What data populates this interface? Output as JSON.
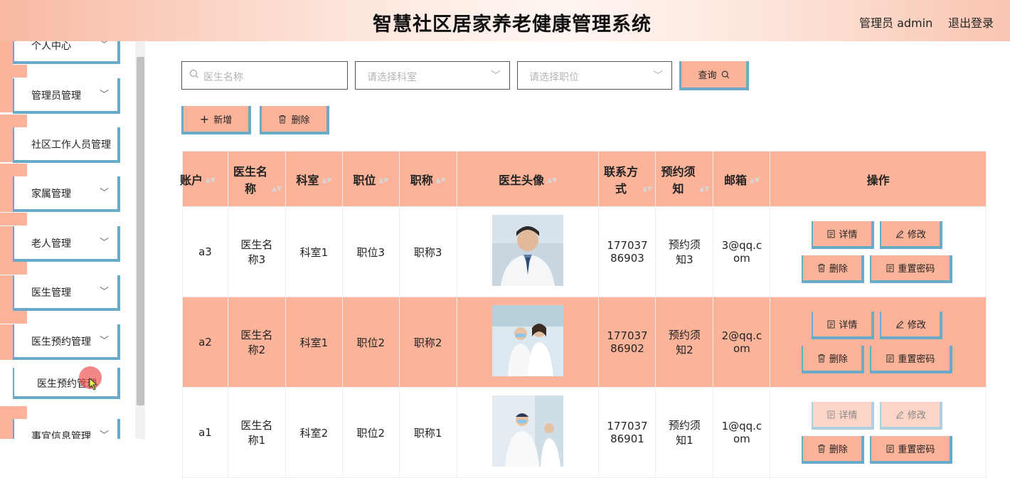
{
  "header": {
    "title": "智慧社区居家养老健康管理系统",
    "user": "管理员 admin",
    "logout": "退出登录"
  },
  "sidebar": {
    "items": [
      {
        "label": "个人中心"
      },
      {
        "label": "管理员管理"
      },
      {
        "label": "社区工作人员管理"
      },
      {
        "label": "家属管理"
      },
      {
        "label": "老人管理"
      },
      {
        "label": "医生管理"
      },
      {
        "label": "医生预约管理"
      },
      {
        "label": "医生预约管理"
      },
      {
        "label": "事宜信息管理"
      }
    ]
  },
  "search": {
    "name_placeholder": "医生名称",
    "dept_placeholder": "请选择科室",
    "position_placeholder": "请选择职位",
    "query_label": "查询"
  },
  "toolbar": {
    "add_label": "新增",
    "delete_label": "删除"
  },
  "table": {
    "headers": [
      "账户",
      "医生名称",
      "科室",
      "职位",
      "职称",
      "医生头像",
      "联系方式",
      "预约须知",
      "邮箱",
      "操作"
    ],
    "rows": [
      {
        "account": "a3",
        "name": "医生名称3",
        "dept": "科室1",
        "position": "职位3",
        "title": "职称3",
        "phone": "17703786903",
        "notice": "预约须知3",
        "email": "3@qq.com"
      },
      {
        "account": "a2",
        "name": "医生名称2",
        "dept": "科室1",
        "position": "职位2",
        "title": "职称2",
        "phone": "17703786902",
        "notice": "预约须知2",
        "email": "2@qq.com"
      },
      {
        "account": "a1",
        "name": "医生名称1",
        "dept": "科室2",
        "position": "职位2",
        "title": "职称1",
        "phone": "17703786901",
        "notice": "预约须知1",
        "email": "1@qq.com"
      }
    ],
    "ops": {
      "detail": "详情",
      "edit": "修改",
      "delete": "删除",
      "reset": "重置密码"
    }
  },
  "colors": {
    "accent": "#fbb39a",
    "border": "#6aaac9"
  }
}
